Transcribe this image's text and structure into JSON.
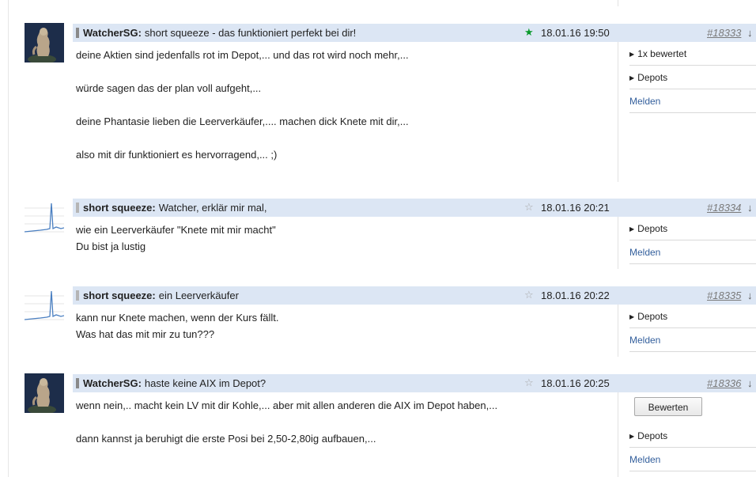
{
  "posts": [
    {
      "author": "WatcherSG:",
      "subject": "short squeeze - das funktioniert perfekt bei dir!",
      "date": "18.01.16 19:50",
      "number": "#18333",
      "arrow": "↓",
      "star": "★",
      "lines": [
        "deine Aktien sind jedenfalls rot im Depot,... und das rot wird noch mehr,...",
        "würde sagen das der plan voll aufgeht,...",
        "deine Phantasie lieben die Leerverkäufer,.... machen dick Knete mit dir,...",
        "also mit dir funktioniert es hervorragend,... ;)"
      ],
      "actions": [
        "1x bewertet",
        "Depots",
        "Melden"
      ]
    },
    {
      "author": "short squeeze:",
      "subject": "Watcher, erklär mir mal,",
      "date": "18.01.16 20:21",
      "number": "#18334",
      "arrow": "↓",
      "star": "☆",
      "lines": [
        "wie ein Leerverkäufer \"Knete mit mir macht\"",
        "Du bist ja lustig"
      ],
      "actions": [
        "Depots",
        "Melden"
      ]
    },
    {
      "author": "short squeeze:",
      "subject": "ein Leerverkäufer",
      "date": "18.01.16 20:22",
      "number": "#18335",
      "arrow": "↓",
      "star": "☆",
      "lines": [
        "kann nur Knete machen, wenn der Kurs fällt.",
        "Was hat das mit mir zu tun???"
      ],
      "actions": [
        "Depots",
        "Melden"
      ]
    },
    {
      "author": "WatcherSG:",
      "subject": "haste keine AIX im Depot?",
      "date": "18.01.16 20:25",
      "number": "#18336",
      "arrow": "↓",
      "star": "☆",
      "lines": [
        "wenn nein,.. macht kein LV mit dir Kohle,... aber mit allen anderen die AIX im Depot haben,...",
        "dann kannst ja beruhigt die erste Posi bei 2,50-2,80ig aufbauen,..."
      ],
      "actions": [
        "Bewerten",
        "Depots",
        "Melden"
      ]
    }
  ],
  "colors": {
    "header_bg": "#dce6f4",
    "star_filled": "#0a9a2c",
    "star_empty": "#a9a9a9",
    "link": "#335f9c"
  }
}
